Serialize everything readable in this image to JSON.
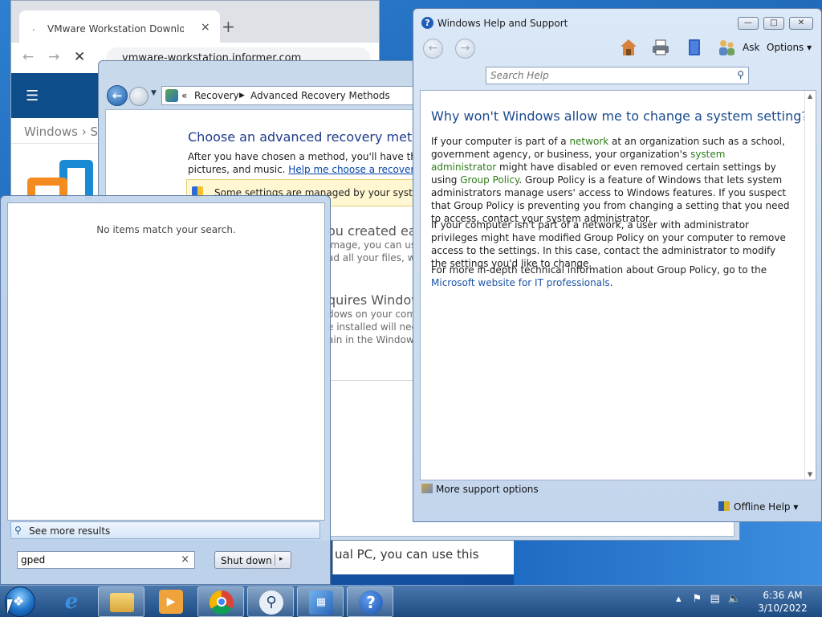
{
  "chrome": {
    "tab_title": "VMware Workstation Download",
    "tab_close": "×",
    "new_tab": "+",
    "url": "vmware-workstation.informer.com",
    "breadcrumb": "Windows › Sy"
  },
  "control_panel": {
    "breadcrumb_sep": "«",
    "path": [
      "Recovery",
      "Advanced Recovery Methods"
    ],
    "heading": "Choose an advanced recovery method",
    "intro_line1": "After you have chosen a method, you'll have the oppo",
    "intro_line2_prefix": "pictures, and music. ",
    "intro_link": "Help me choose a recovery meth",
    "info_banner": "Some settings are managed by your system adm",
    "section1_title": "ou created earl",
    "section1_lines": [
      "image, you can use",
      "ad all your files, with"
    ],
    "section2_title": "quires Window",
    "section2_lines": [
      "dows on your comp",
      "e installed will need",
      "ain in the Windows."
    ],
    "bottom_text": "ual PC, you can use this"
  },
  "start_menu": {
    "no_items": "No items match your search.",
    "see_more": "See more results",
    "search_value": "gped",
    "clear": "×",
    "shutdown_label": "Shut down",
    "shutdown_arrow": "▸"
  },
  "help": {
    "title": "Windows Help and Support",
    "ask": "Ask",
    "options": "Options ▾",
    "search_placeholder": "Search Help",
    "heading": "Why won't Windows allow me to change a system setting?",
    "p1": {
      "t1": "If your computer is part of a ",
      "l1": "network",
      "t2": " at an organization such as a school, government agency, or business, your organization's ",
      "l2": "system administrator",
      "t3": " might have disabled or even removed certain settings by using ",
      "l3": "Group Policy",
      "t4": ". Group Policy is a feature of Windows that lets system administrators manage users' access to Windows features. If you suspect that Group Policy is preventing you from changing a setting that you need to access, contact your system administrator."
    },
    "p2": "If your computer isn't part of a network, a user with administrator privileges might have modified Group Policy on your computer to remove access to the settings. In this case, contact the administrator to modify the settings you'd like to change.",
    "p3": {
      "t1": "For more in-depth technical information about Group Policy, go to the ",
      "l1": "Microsoft website for IT professionals",
      "t2": "."
    },
    "more_support": "More support options",
    "offline": "Offline Help ▾"
  },
  "taskbar": {
    "apps": [
      "internet-explorer",
      "file-explorer",
      "media-player",
      "chrome",
      "search-app",
      "control-panel",
      "help-and-support"
    ],
    "time": "6:36 AM",
    "date": "3/10/2022"
  }
}
